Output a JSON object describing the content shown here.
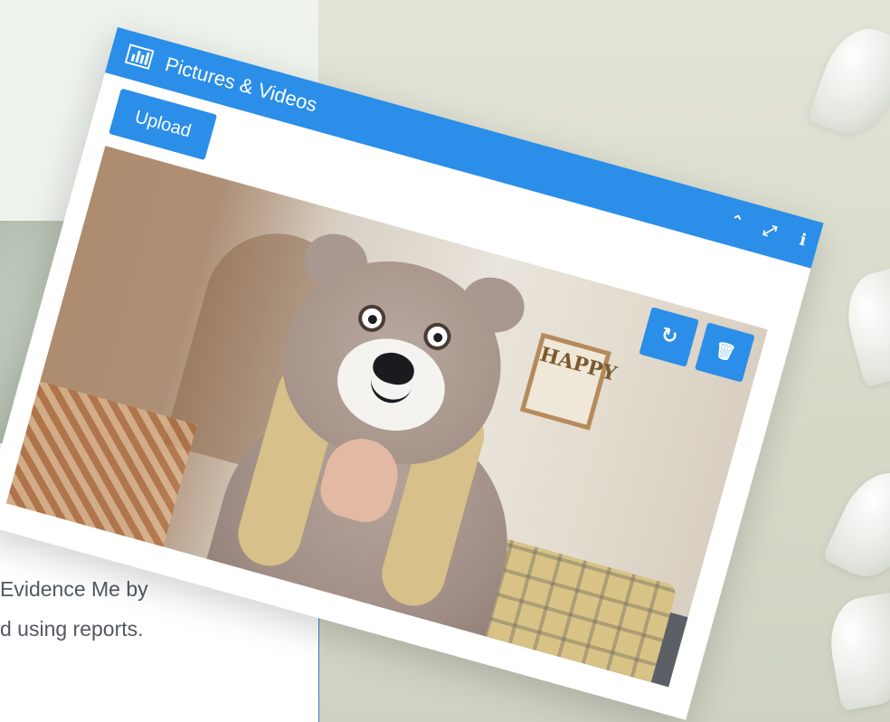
{
  "window": {
    "title": "Pictures & Videos",
    "upload_label": "Upload",
    "controls": {
      "collapse_icon": "chevron-up",
      "expand_icon": "expand-arrows",
      "info_icon": "info"
    },
    "photo_actions": {
      "rotate_icon": "rotate",
      "delete_icon": "trash"
    },
    "accent_color": "#2b8ee8",
    "photo_frame_text": "HAPPY"
  },
  "background_text": {
    "line1": "Evidence Me by",
    "line2": "d using reports."
  },
  "glyphs": {
    "collapse": "⌃",
    "expand": "⤢",
    "info": "i",
    "rotate": "↻",
    "delete": "🗑"
  }
}
